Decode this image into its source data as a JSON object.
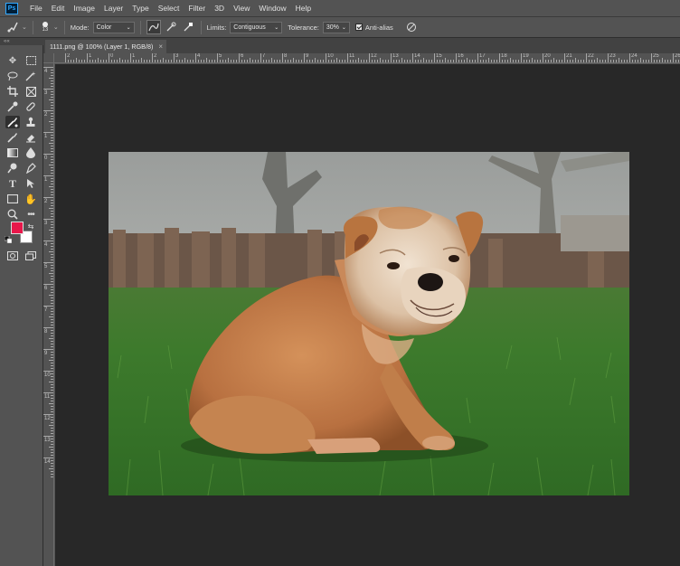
{
  "menu": {
    "logo": "Ps",
    "items": [
      "File",
      "Edit",
      "Image",
      "Layer",
      "Type",
      "Select",
      "Filter",
      "3D",
      "View",
      "Window",
      "Help"
    ]
  },
  "options": {
    "brush_size": "13",
    "mode_label": "Mode:",
    "mode_value": "Color",
    "limits_label": "Limits:",
    "limits_value": "Contiguous",
    "tolerance_label": "Tolerance:",
    "tolerance_value": "30%",
    "antialias_label": "Anti-alias"
  },
  "document": {
    "tab_title": "1111.png @ 100% (Layer 1, RGB/8)",
    "close": "×"
  },
  "rulers": {
    "top": [
      "2",
      "1",
      "0",
      "1",
      "2",
      "3",
      "4",
      "5",
      "6",
      "7",
      "8",
      "9",
      "10",
      "11",
      "12",
      "13",
      "14",
      "15",
      "16",
      "17",
      "18",
      "19",
      "20",
      "21",
      "22",
      "23",
      "24",
      "25",
      "26"
    ],
    "left": [
      "4",
      "3",
      "2",
      "1",
      "0",
      "1",
      "2",
      "3",
      "4",
      "5",
      "6",
      "7",
      "8",
      "9",
      "10",
      "11",
      "12",
      "13",
      "14"
    ]
  },
  "colors": {
    "foreground": "#e8174a",
    "background": "#ffffff",
    "workspace": "#282828",
    "chrome": "#535353"
  },
  "tools": [
    "move-icon",
    "marquee-icon",
    "lasso-icon",
    "magic-wand-icon",
    "crop-icon",
    "frame-icon",
    "eyedropper-icon",
    "healing-brush-icon",
    "color-replacement-icon",
    "clone-stamp-icon",
    "history-brush-icon",
    "eraser-icon",
    "gradient-icon",
    "blur-icon",
    "dodge-icon",
    "pen-icon",
    "type-icon",
    "path-selection-icon",
    "rectangle-icon",
    "hand-icon",
    "zoom-icon",
    "more-tools-icon"
  ]
}
